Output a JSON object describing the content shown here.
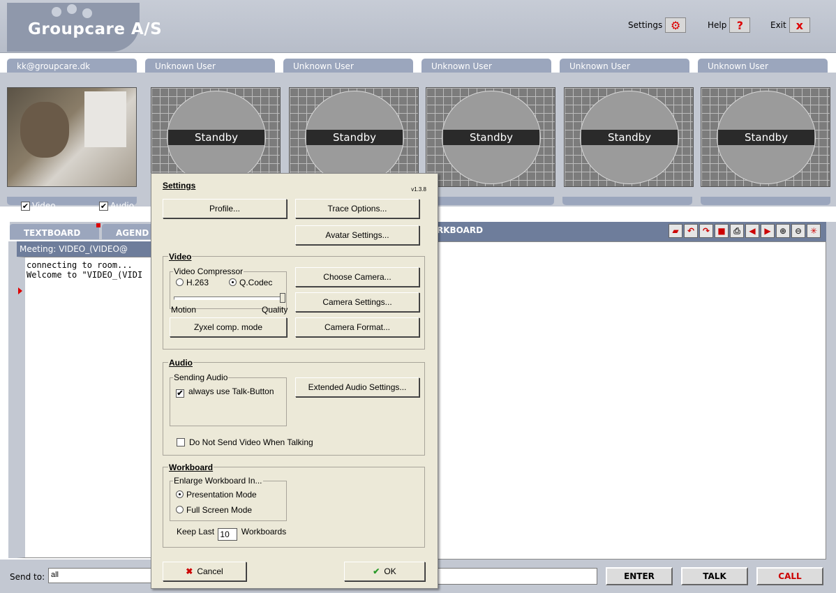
{
  "header": {
    "title": "Groupcare A/S",
    "settings_label": "Settings",
    "help_label": "Help",
    "help_icon": "?",
    "exit_label": "Exit",
    "exit_icon": "x",
    "settings_icon": "gear-icon"
  },
  "users": [
    {
      "name": "kk@groupcare.dk"
    },
    {
      "name": "Unknown User"
    },
    {
      "name": "Unknown User"
    },
    {
      "name": "Unknown User"
    },
    {
      "name": "Unknown User"
    },
    {
      "name": "Unknown User"
    }
  ],
  "standby_label": "Standby",
  "local_controls": {
    "video_label": "Video",
    "audio_label": "Audio",
    "video_checked": "✔",
    "audio_checked": "✔"
  },
  "textboard": {
    "tab1": "TEXTBOARD",
    "tab2": "AGEND",
    "meeting": "Meeting: VIDEO_(VIDEO@",
    "lines": [
      "connecting to room...",
      "Welcome to \"VIDEO_(VIDI"
    ]
  },
  "workboard": {
    "title": "RKBOARD"
  },
  "bottom": {
    "sendto_label": "Send to:",
    "sendto_value": "all",
    "enter_label": "ENTER",
    "talk_label": "TALK",
    "call_label": "CALL"
  },
  "dialog": {
    "title": "Settings",
    "version": "v1.3.8",
    "profile_btn": "Profile...",
    "trace_btn": "Trace Options...",
    "avatar_btn": "Avatar Settings...",
    "video": {
      "title": "Video",
      "compressor_label": "Video Compressor",
      "opt_h263": "H.263",
      "opt_qcodec": "Q.Codec",
      "motion_label": "Motion",
      "quality_label": "Quality",
      "slider_value_fraction": 1.0,
      "zyxel_btn": "Zyxel comp. mode",
      "choose_camera_btn": "Choose Camera...",
      "camera_settings_btn": "Camera Settings...",
      "camera_format_btn": "Camera Format..."
    },
    "audio": {
      "title": "Audio",
      "sending_label": "Sending Audio",
      "talk_button_label": "always use Talk-Button",
      "talk_button_check": "✔",
      "extended_btn": "Extended Audio Settings...",
      "no_video_label": "Do Not Send Video When Talking"
    },
    "workboard": {
      "title": "Workboard",
      "enlarge_label": "Enlarge Workboard In...",
      "presentation_label": "Presentation Mode",
      "fullscreen_label": "Full Screen Mode",
      "keep_last_label": "Keep Last",
      "keep_last_value": "10",
      "workboards_label": "Workboards"
    },
    "cancel_btn": "Cancel",
    "ok_btn": "OK"
  },
  "colors": {
    "accent": "#6e7d9b",
    "tab": "#9ba6bd",
    "call": "#cc0000"
  }
}
